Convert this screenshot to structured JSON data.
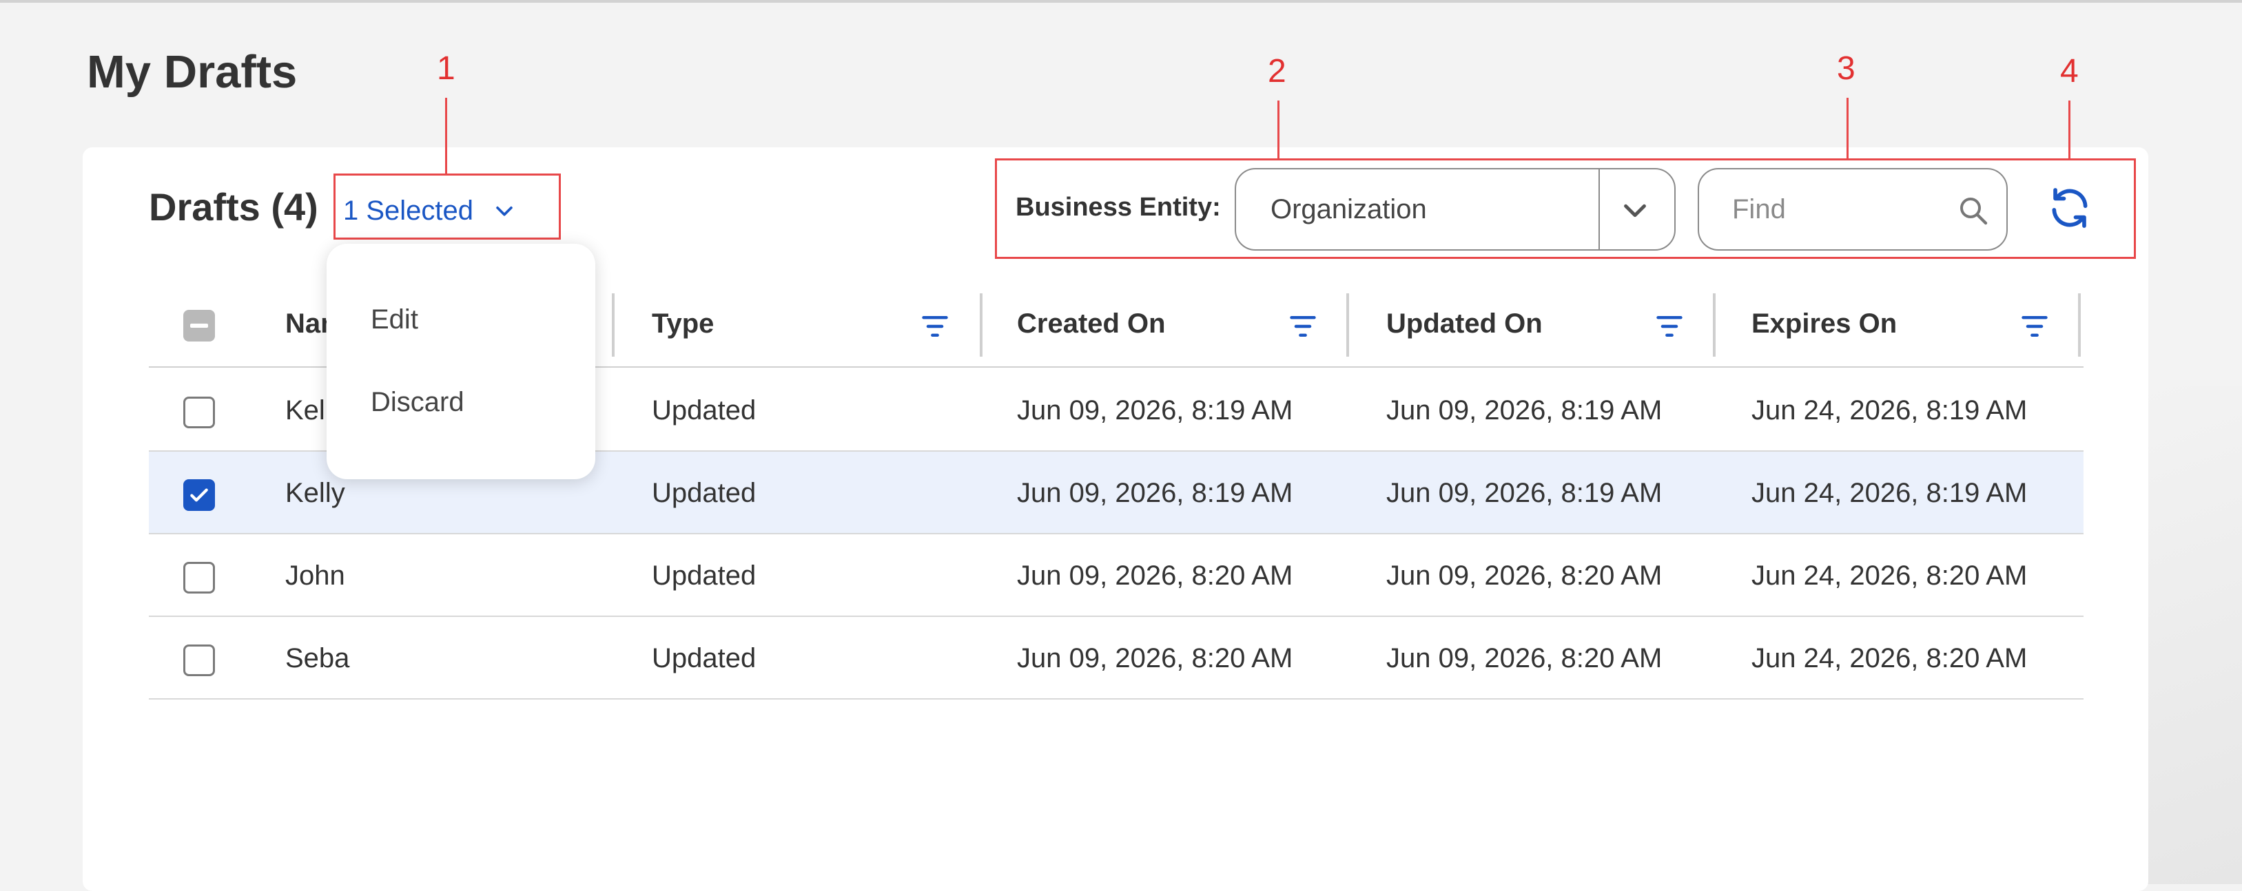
{
  "page": {
    "title": "My Drafts"
  },
  "card": {
    "title": "Drafts (4)",
    "selection_label": "1 Selected",
    "menu": {
      "items": [
        "Edit",
        "Discard"
      ]
    }
  },
  "toolbar": {
    "business_entity_label": "Business Entity:",
    "business_entity_value": "Organization",
    "find_placeholder": "Find"
  },
  "table": {
    "columns": [
      "Name",
      "Type",
      "Created On",
      "Updated On",
      "Expires On"
    ],
    "rows": [
      {
        "checked": false,
        "name": "Kelly",
        "type": "Updated",
        "created": "Jun 09, 2026, 8:19 AM",
        "updated": "Jun 09, 2026, 8:19 AM",
        "expires": "Jun 24, 2026, 8:19 AM"
      },
      {
        "checked": true,
        "name": "Kelly",
        "type": "Updated",
        "created": "Jun 09, 2026, 8:19 AM",
        "updated": "Jun 09, 2026, 8:19 AM",
        "expires": "Jun 24, 2026, 8:19 AM"
      },
      {
        "checked": false,
        "name": "John",
        "type": "Updated",
        "created": "Jun 09, 2026, 8:20 AM",
        "updated": "Jun 09, 2026, 8:20 AM",
        "expires": "Jun 24, 2026, 8:20 AM"
      },
      {
        "checked": false,
        "name": "Seba",
        "type": "Updated",
        "created": "Jun 09, 2026, 8:20 AM",
        "updated": "Jun 09, 2026, 8:20 AM",
        "expires": "Jun 24, 2026, 8:20 AM"
      }
    ]
  },
  "annotations": {
    "labels": [
      "1",
      "2",
      "3",
      "4"
    ]
  },
  "colors": {
    "accent": "#1a56c4",
    "annotation": "#e8484a",
    "selected_row": "#ebf1fc"
  }
}
